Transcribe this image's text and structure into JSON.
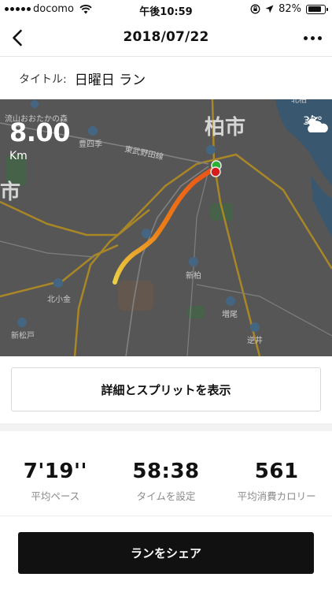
{
  "status_bar": {
    "carrier": "docomo",
    "time": "午後10:59",
    "battery": "82%",
    "battery_level": 0.82
  },
  "nav": {
    "title": "2018/07/22"
  },
  "run": {
    "title_label": "タイトル:",
    "title_value": "日曜日 ラン"
  },
  "map": {
    "distance_value": "8.00",
    "distance_unit": "Km",
    "temperature": "32°",
    "weather_icon": "partly-cloudy-icon",
    "city_label": "柏市",
    "city_label_left": "市",
    "places": [
      "流山おおたかの森",
      "豊四季",
      "東武野田線",
      "北小金",
      "新松戸",
      "新柏",
      "増尾",
      "逆井",
      "北柏"
    ],
    "track_colors": [
      "#ffe14a",
      "#ff8a1a",
      "#ff5a1a"
    ],
    "start_color": "#2fbf3a",
    "end_color": "#e82020"
  },
  "detail_button": {
    "label": "詳細とスプリットを表示"
  },
  "stats": [
    {
      "value": "7'19''",
      "label": "平均ペース"
    },
    {
      "value": "58:38",
      "label": "タイムを設定"
    },
    {
      "value": "561",
      "label": "平均消費カロリー"
    }
  ],
  "share_button": {
    "label": "ランをシェア"
  }
}
